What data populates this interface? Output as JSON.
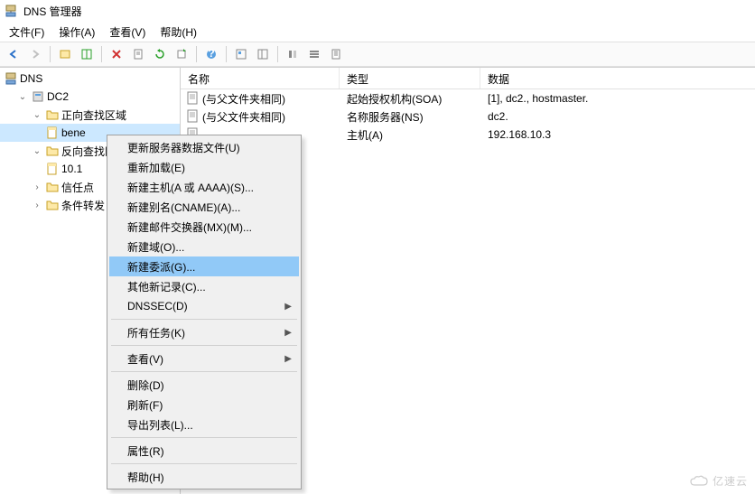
{
  "title": "DNS 管理器",
  "menu": {
    "file": "文件(F)",
    "action": "操作(A)",
    "view": "查看(V)",
    "help": "帮助(H)"
  },
  "tree": {
    "root": "DNS",
    "server": "DC2",
    "fwd_zone": "正向查找区域",
    "fwd_item": "bene",
    "rev_zone": "反向查找区域",
    "rev_item": "10.1",
    "trust": "信任点",
    "cond": "条件转发"
  },
  "columns": {
    "name": "名称",
    "type": "类型",
    "data": "数据"
  },
  "rows": [
    {
      "name": "(与父文件夹相同)",
      "type": "起始授权机构(SOA)",
      "data": "[1], dc2., hostmaster."
    },
    {
      "name": "(与父文件夹相同)",
      "type": "名称服务器(NS)",
      "data": "dc2."
    },
    {
      "name": "",
      "type": "主机(A)",
      "data": "192.168.10.3"
    }
  ],
  "ctx": {
    "update": "更新服务器数据文件(U)",
    "reload": "重新加载(E)",
    "new_host": "新建主机(A 或 AAAA)(S)...",
    "new_alias": "新建别名(CNAME)(A)...",
    "new_mx": "新建邮件交换器(MX)(M)...",
    "new_domain": "新建域(O)...",
    "new_delegation": "新建委派(G)...",
    "other_records": "其他新记录(C)...",
    "dnssec": "DNSSEC(D)",
    "all_tasks": "所有任务(K)",
    "view": "查看(V)",
    "delete": "删除(D)",
    "refresh": "刷新(F)",
    "export": "导出列表(L)...",
    "properties": "属性(R)",
    "help": "帮助(H)"
  },
  "watermark": "亿速云"
}
